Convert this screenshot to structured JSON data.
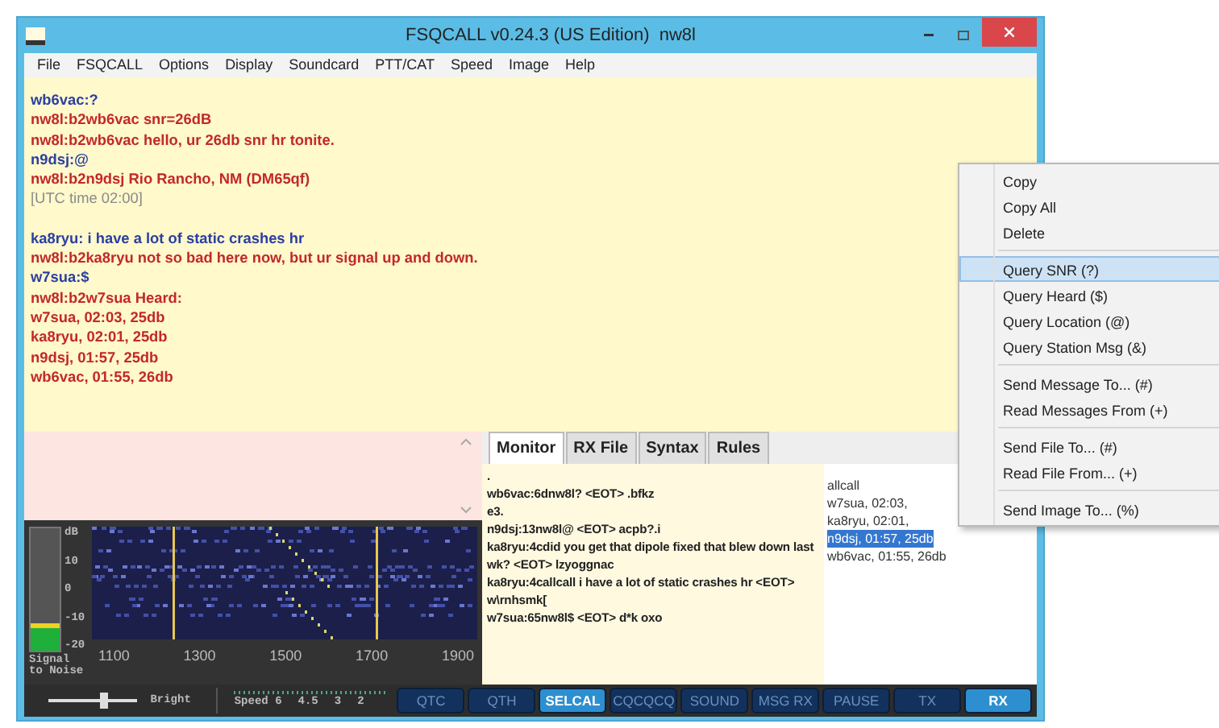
{
  "window": {
    "title": "FSQCALL v0.24.3 (US Edition)  nw8l"
  },
  "menu": [
    "File",
    "FSQCALL",
    "Options",
    "Display",
    "Soundcard",
    "PTT/CAT",
    "Speed",
    "Image",
    "Help"
  ],
  "chat": [
    {
      "kind": "call",
      "text": "wb6vac:?"
    },
    {
      "kind": "reply",
      "text": "nw8l:b2wb6vac snr=26dB"
    },
    {
      "kind": "reply",
      "text": "nw8l:b2wb6vac hello, ur 26db snr hr tonite."
    },
    {
      "kind": "call",
      "text": "n9dsj:@"
    },
    {
      "kind": "reply",
      "text": "nw8l:b2n9dsj Rio Rancho, NM (DM65qf)"
    },
    {
      "kind": "system",
      "text": "[UTC time 02:00]"
    },
    {
      "kind": "gap"
    },
    {
      "kind": "call",
      "text": "ka8ryu: i have a lot of static crashes hr"
    },
    {
      "kind": "reply",
      "text": "nw8l:b2ka8ryu not so bad here now, but ur signal up and down."
    },
    {
      "kind": "call",
      "text": "w7sua:$"
    },
    {
      "kind": "reply",
      "text": "nw8l:b2w7sua Heard:"
    },
    {
      "kind": "reply",
      "text": "w7sua, 02:03, 25db"
    },
    {
      "kind": "reply",
      "text": "ka8ryu, 02:01, 25db"
    },
    {
      "kind": "reply",
      "text": "n9dsj, 01:57, 25db"
    },
    {
      "kind": "reply",
      "text": "wb6vac, 01:55, 26db"
    }
  ],
  "meter": {
    "unit": "dB",
    "scale": [
      "10",
      "0",
      "-10",
      "-20"
    ],
    "level": 0.22,
    "label": "Signal to Noise"
  },
  "waterfall": {
    "ticks": [
      "1100",
      "1300",
      "1500",
      "1700",
      "1900"
    ]
  },
  "tabs": [
    {
      "label": "Monitor",
      "selected": true
    },
    {
      "label": "RX File",
      "selected": false
    },
    {
      "label": "Syntax",
      "selected": false
    },
    {
      "label": "Rules",
      "selected": false
    }
  ],
  "monitor": [
    ".",
    "wb6vac:6dnw8l?  <EOT> .bfkz",
    "e3.",
    "n9dsj:13nw8l@  <EOT>  acpb?.i",
    "ka8ryu:4cdid you get that dipole fixed that blew down last wk?  <EOT>  lzyoggnac",
    "ka8ryu:4callcall i have a lot of static crashes hr  <EOT> w\\rnhsmk[",
    "w7sua:65nw8l$  <EOT>  d*k oxo"
  ],
  "heard": [
    {
      "text": "allcall",
      "selected": false
    },
    {
      "text": "w7sua, 02:03,",
      "selected": false
    },
    {
      "text": "ka8ryu, 02:01,",
      "selected": false
    },
    {
      "text": "n9dsj, 01:57, 25db",
      "selected": true
    },
    {
      "text": "wb6vac, 01:55, 26db",
      "selected": false
    }
  ],
  "brightness": {
    "label": "Bright",
    "level": 0.6
  },
  "speed": {
    "labels": [
      "Speed 6",
      "4.5",
      "3",
      "2"
    ]
  },
  "buttons": [
    {
      "label": "QTC",
      "on": false
    },
    {
      "label": "QTH",
      "on": false
    },
    {
      "label": "SELCAL",
      "on": true
    },
    {
      "label": "CQCQCQ",
      "on": false
    },
    {
      "label": "SOUND",
      "on": false
    },
    {
      "label": "MSG RX",
      "on": false
    },
    {
      "label": "PAUSE",
      "on": false
    },
    {
      "label": "TX",
      "on": false
    },
    {
      "label": "RX",
      "on": true
    }
  ],
  "context_menu": [
    {
      "label": "Copy",
      "selected": false
    },
    {
      "label": "Copy All",
      "selected": false
    },
    {
      "label": "Delete",
      "selected": false
    },
    {
      "kind": "separator"
    },
    {
      "label": "Query SNR (?)",
      "selected": true
    },
    {
      "label": "Query Heard ($)",
      "selected": false
    },
    {
      "label": "Query Location (@)",
      "selected": false
    },
    {
      "label": "Query Station Msg (&)",
      "selected": false
    },
    {
      "kind": "separator"
    },
    {
      "label": "Send Message To... (#)",
      "selected": false
    },
    {
      "label": "Read Messages From (+)",
      "selected": false
    },
    {
      "kind": "separator"
    },
    {
      "label": "Send File To... (#)",
      "selected": false
    },
    {
      "label": "Read File From... (+)",
      "selected": false
    },
    {
      "kind": "separator"
    },
    {
      "label": "Send Image To... (%)",
      "selected": false
    }
  ]
}
